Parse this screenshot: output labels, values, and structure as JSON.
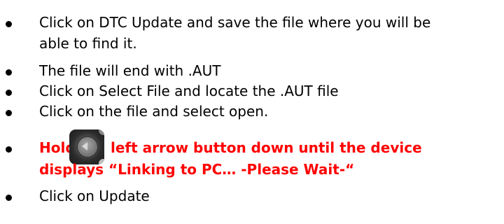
{
  "bullets": [
    {
      "line1": "Click on DTC Update and save the file where you will be",
      "line2": "able to find it."
    },
    {
      "text": "The file will end with .AUT"
    },
    {
      "text": "Click on Select File and locate the .AUT file"
    },
    {
      "text": "Click on the file and select open."
    },
    {
      "hold_label": "Hold",
      "after_icon": "left arrow button down until the device",
      "line2": "displays “Linking to PC… -Please Wait-“",
      "icon": "left-arrow-button-icon",
      "color": "#ff0000"
    },
    {
      "text": "Click on Update"
    }
  ]
}
